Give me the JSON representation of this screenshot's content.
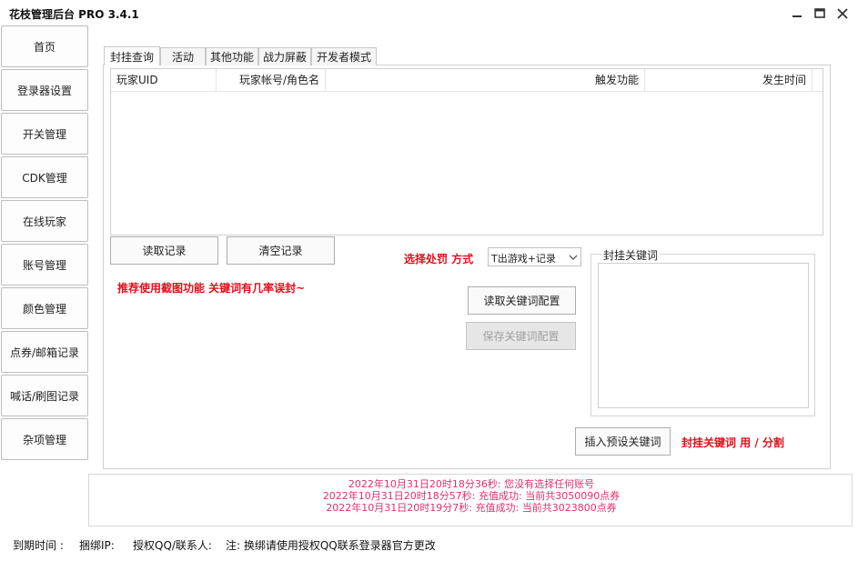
{
  "app": {
    "title": "花枝管理后台 PRO 3.4.1"
  },
  "window_controls": {
    "minimize": "minimize-icon",
    "maximize": "maximize-icon",
    "close": "close-icon"
  },
  "sidebar": {
    "items": [
      {
        "label": "首页"
      },
      {
        "label": "登录器设置"
      },
      {
        "label": "开关管理"
      },
      {
        "label": "CDK管理"
      },
      {
        "label": "在线玩家"
      },
      {
        "label": "账号管理"
      },
      {
        "label": "颜色管理"
      },
      {
        "label": "点券/邮箱记录"
      },
      {
        "label": "喊话/刷图记录"
      },
      {
        "label": "杂项管理"
      }
    ]
  },
  "tabs": [
    {
      "label": "封挂查询",
      "active": true
    },
    {
      "label": "活动"
    },
    {
      "label": "其他功能"
    },
    {
      "label": "战力屏蔽"
    },
    {
      "label": "开发者模式"
    }
  ],
  "table": {
    "columns": [
      "玩家UID",
      "玩家帐号/角色名",
      "触发功能",
      "发生时间"
    ],
    "rows": []
  },
  "buttons": {
    "read_records": "读取记录",
    "clear_records": "清空记录",
    "read_keyword_config": "读取关键词配置",
    "save_keyword_config": "保存关键词配置",
    "insert_preset_keywords": "插入预设关键词"
  },
  "punishment": {
    "label": "选择处罚 方式",
    "selected": "T出游戏+记录"
  },
  "hint_text": "推荐使用截图功能 关键词有几率误封~",
  "keywords": {
    "group_title": "封挂关键词",
    "value": "",
    "separator_hint": "封挂关键词 用 / 分割"
  },
  "log": [
    "2022年10月31日20时18分36秒: 您没有选择任何账号",
    "2022年10月31日20时18分57秒: 充值成功: 当前共3050090点券",
    "2022年10月31日20时19分7秒: 充值成功: 当前共3023800点券"
  ],
  "status_bar": {
    "expire": "到期时间 :",
    "bound_ip": "捆绑IP:",
    "auth_qq": "授权QQ/联系人:",
    "note": "注: 换绑请使用授权QQ联系登录器官方更改"
  },
  "colors": {
    "accent_red": "#e0101a",
    "log_pink": "#e0306e"
  }
}
